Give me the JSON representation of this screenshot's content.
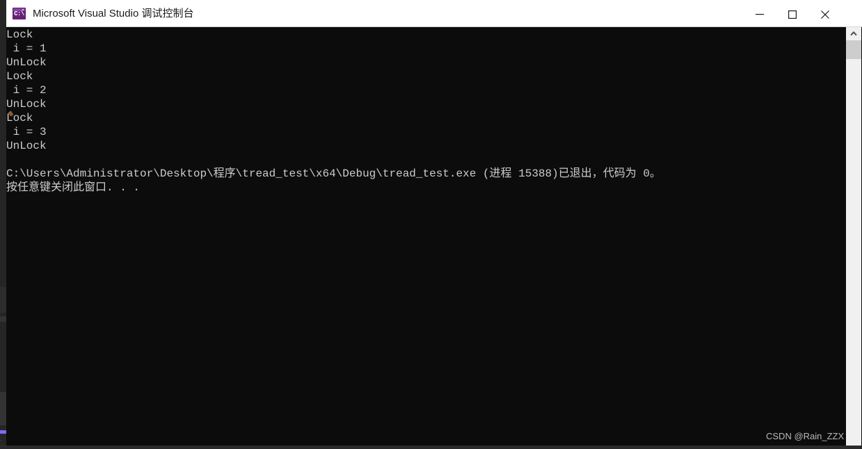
{
  "window": {
    "title": "Microsoft Visual Studio 调试控制台",
    "icon": "console-app-icon",
    "icon_glyph": "C:\\",
    "controls": {
      "minimize": "minimize-icon",
      "maximize": "maximize-icon",
      "close": "close-icon"
    }
  },
  "console": {
    "background_color": "#0c0c0c",
    "text_color": "#cccccc",
    "lines": [
      "Lock",
      " i = 1",
      "UnLock",
      "Lock",
      " i = 2",
      "UnLock",
      "Lock",
      " i = 3",
      "UnLock",
      "",
      "C:\\Users\\Administrator\\Desktop\\程序\\tread_test\\x64\\Debug\\tread_test.exe (进程 15388)已退出，代码为 0。",
      "按任意键关闭此窗口. . ."
    ]
  },
  "scrollbar": {
    "up_arrow": "chevron-up-icon",
    "thumb_color": "#cdcdcd",
    "track_color": "#f0f0f0"
  },
  "watermark": {
    "text": "CSDN @Rain_ZZX"
  },
  "background": {
    "accent_color": "#7a6ff0",
    "dots": "· ·"
  }
}
